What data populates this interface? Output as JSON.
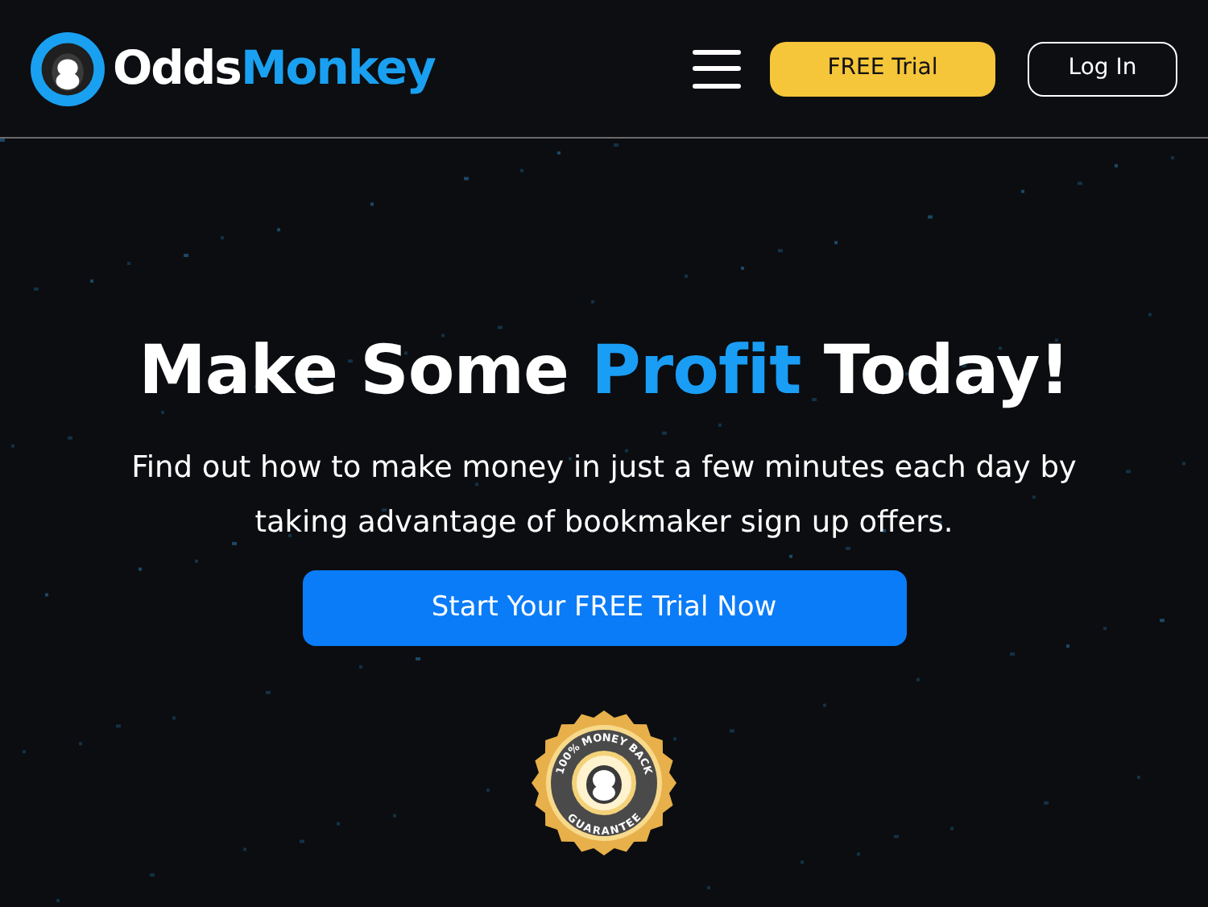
{
  "header": {
    "logo": {
      "first": "Odds",
      "second": "Monkey"
    },
    "free_trial_button": "FREE Trial",
    "login_button": "Log In"
  },
  "hero": {
    "headline": [
      {
        "text": "Make Some ",
        "highlight": false
      },
      {
        "text": "Profit",
        "highlight": true
      },
      {
        "text": " Today!",
        "highlight": false
      }
    ],
    "subtitle": "Find out how to make money in just a few minutes each day by taking advantage of bookmaker sign up offers.",
    "cta_button": "Start Your FREE Trial Now",
    "badge": {
      "top": "100% MONEY BACK",
      "bottom": "GUARANTEE"
    }
  }
}
